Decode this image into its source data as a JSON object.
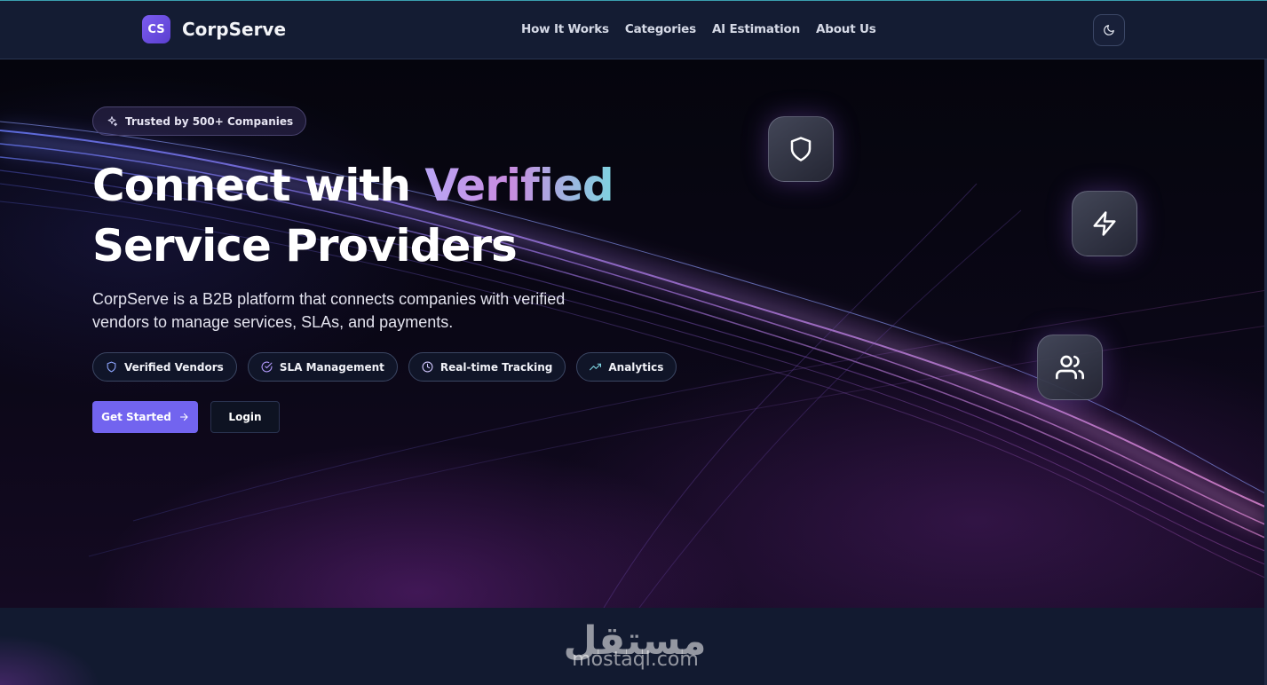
{
  "brand": {
    "badge": "CS",
    "name": "CorpServe"
  },
  "nav": {
    "items": [
      "How It Works",
      "Categories",
      "AI Estimation",
      "About Us"
    ]
  },
  "theme_toggle": {
    "icon": "moon-icon"
  },
  "hero": {
    "badge": "Trusted by 500+ Companies",
    "headline_part1": "Connect with ",
    "headline_accent": "Verified",
    "headline_part2": "Service Providers",
    "description": "CorpServe is a B2B platform that connects companies with verified vendors to manage services, SLAs, and payments.",
    "features": [
      {
        "label": "Verified Vendors",
        "icon": "shield-icon"
      },
      {
        "label": "SLA Management",
        "icon": "check-circle-icon"
      },
      {
        "label": "Real-time Tracking",
        "icon": "clock-icon"
      },
      {
        "label": "Analytics",
        "icon": "trending-up-icon"
      }
    ],
    "cta_primary": "Get Started",
    "cta_secondary": "Login",
    "floating_icons": [
      "shield-icon",
      "zap-icon",
      "users-icon"
    ]
  },
  "watermark": {
    "arabic": "مستقل",
    "text": "mostaql.com"
  },
  "colors": {
    "accent": "#7264ef",
    "nav_bg": "#141c33",
    "gradient_text": [
      "#b9a6f5",
      "#c98be0",
      "#7ed3e0"
    ]
  }
}
